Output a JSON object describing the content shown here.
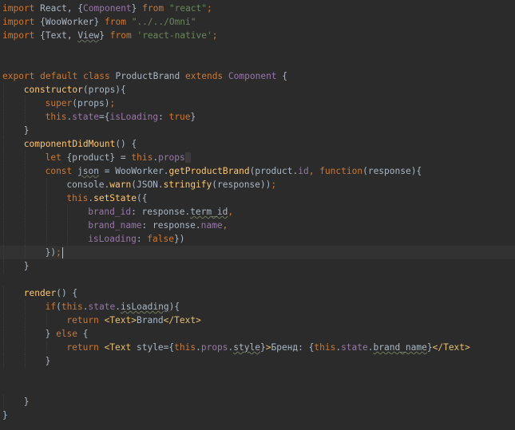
{
  "editor": {
    "lines": [
      {
        "indent": 0,
        "tokens": [
          [
            "kw",
            "import"
          ],
          [
            "plain",
            " React, {"
          ],
          [
            "prop",
            "Component"
          ],
          [
            "plain",
            "} "
          ],
          [
            "kw",
            "from"
          ],
          [
            "plain",
            " "
          ],
          [
            "str",
            "\"react\""
          ],
          [
            "kw",
            ";"
          ]
        ]
      },
      {
        "indent": 0,
        "tokens": [
          [
            "kw",
            "import"
          ],
          [
            "plain",
            " {WooWorker} "
          ],
          [
            "kw",
            "from"
          ],
          [
            "plain",
            " "
          ],
          [
            "str",
            "\"../../Omni\""
          ]
        ]
      },
      {
        "indent": 0,
        "tokens": [
          [
            "kw",
            "import"
          ],
          [
            "plain",
            " {Text, "
          ],
          [
            "dim",
            "View"
          ],
          [
            "plain",
            "} "
          ],
          [
            "kw",
            "from"
          ],
          [
            "plain",
            " "
          ],
          [
            "str",
            "'react-native'"
          ],
          [
            "kw",
            ";"
          ]
        ]
      },
      {
        "indent": 0,
        "tokens": []
      },
      {
        "indent": 0,
        "tokens": []
      },
      {
        "indent": 0,
        "tokens": [
          [
            "kw",
            "export default class"
          ],
          [
            "plain",
            " ProductBrand "
          ],
          [
            "kw",
            "extends"
          ],
          [
            "plain",
            " "
          ],
          [
            "prop",
            "Component"
          ],
          [
            "plain",
            " {"
          ]
        ]
      },
      {
        "indent": 1,
        "tokens": [
          [
            "fn",
            "constructor"
          ],
          [
            "plain",
            "(props){"
          ]
        ]
      },
      {
        "indent": 2,
        "tokens": [
          [
            "kw",
            "super"
          ],
          [
            "plain",
            "(props)"
          ],
          [
            "kw",
            ";"
          ]
        ]
      },
      {
        "indent": 2,
        "tokens": [
          [
            "kw",
            "this"
          ],
          [
            "plain",
            "."
          ],
          [
            "prop",
            "state"
          ],
          [
            "plain",
            "={"
          ],
          [
            "prop",
            "isLoading"
          ],
          [
            "plain",
            ": "
          ],
          [
            "kw",
            "true"
          ],
          [
            "plain",
            "}"
          ]
        ]
      },
      {
        "indent": 1,
        "tokens": [
          [
            "plain",
            "}"
          ]
        ]
      },
      {
        "indent": 1,
        "tokens": [
          [
            "fn",
            "componentDidMount"
          ],
          [
            "plain",
            "() {"
          ]
        ]
      },
      {
        "indent": 2,
        "tokens": [
          [
            "kw",
            "let"
          ],
          [
            "plain",
            " {product} = "
          ],
          [
            "kw",
            "this"
          ],
          [
            "plain",
            "."
          ],
          [
            "prop",
            "props"
          ],
          [
            "box",
            " "
          ]
        ]
      },
      {
        "indent": 2,
        "tokens": [
          [
            "kw",
            "const"
          ],
          [
            "plain",
            " "
          ],
          [
            "dim",
            "json"
          ],
          [
            "plain",
            " = WooWorker."
          ],
          [
            "fn",
            "getProductBrand"
          ],
          [
            "plain",
            "(product."
          ],
          [
            "prop",
            "id"
          ],
          [
            "kw",
            ","
          ],
          [
            "plain",
            " "
          ],
          [
            "kw",
            "function"
          ],
          [
            "plain",
            "(response){"
          ]
        ]
      },
      {
        "indent": 3,
        "tokens": [
          [
            "plain",
            "console."
          ],
          [
            "fn",
            "warn"
          ],
          [
            "plain",
            "(JSON."
          ],
          [
            "fn",
            "stringify"
          ],
          [
            "plain",
            "(response))"
          ],
          [
            "kw",
            ";"
          ]
        ]
      },
      {
        "indent": 3,
        "tokens": [
          [
            "kw",
            "this"
          ],
          [
            "plain",
            "."
          ],
          [
            "fn",
            "setState"
          ],
          [
            "plain",
            "({"
          ]
        ]
      },
      {
        "indent": 4,
        "tokens": [
          [
            "prop",
            "brand_id"
          ],
          [
            "plain",
            ": response."
          ],
          [
            "typo",
            "term_id"
          ],
          [
            "kw",
            ","
          ]
        ]
      },
      {
        "indent": 4,
        "tokens": [
          [
            "prop",
            "brand_name"
          ],
          [
            "plain",
            ": response."
          ],
          [
            "prop",
            "name"
          ],
          [
            "kw",
            ","
          ]
        ]
      },
      {
        "indent": 4,
        "tokens": [
          [
            "prop",
            "isLoading"
          ],
          [
            "plain",
            ": "
          ],
          [
            "kw",
            "false"
          ],
          [
            "plain",
            "})"
          ]
        ]
      },
      {
        "indent": 2,
        "current": true,
        "tokens": [
          [
            "plain",
            "})"
          ],
          [
            "kw",
            ";"
          ],
          [
            "caret",
            ""
          ]
        ]
      },
      {
        "indent": 1,
        "tokens": [
          [
            "plain",
            "}"
          ]
        ]
      },
      {
        "indent": 0,
        "tokens": []
      },
      {
        "indent": 1,
        "tokens": [
          [
            "fn",
            "render"
          ],
          [
            "plain",
            "() {"
          ]
        ]
      },
      {
        "indent": 2,
        "tokens": [
          [
            "kw",
            "if"
          ],
          [
            "plain",
            "("
          ],
          [
            "kw",
            "this"
          ],
          [
            "plain",
            "."
          ],
          [
            "prop",
            "state"
          ],
          [
            "plain",
            "."
          ],
          [
            "typo",
            "isLoading"
          ],
          [
            "plain",
            "){"
          ]
        ]
      },
      {
        "indent": 3,
        "tokens": [
          [
            "kw",
            "return"
          ],
          [
            "plain",
            " "
          ],
          [
            "tag",
            "<Text>"
          ],
          [
            "plain",
            "Brand"
          ],
          [
            "tag",
            "</Text>"
          ]
        ]
      },
      {
        "indent": 2,
        "tokens": [
          [
            "plain",
            "} "
          ],
          [
            "kw",
            "else"
          ],
          [
            "plain",
            " {"
          ]
        ]
      },
      {
        "indent": 3,
        "tokens": [
          [
            "kw",
            "return"
          ],
          [
            "plain",
            " "
          ],
          [
            "tag",
            "<Text "
          ],
          [
            "plain",
            "style={"
          ],
          [
            "kw",
            "this"
          ],
          [
            "plain",
            "."
          ],
          [
            "prop",
            "props"
          ],
          [
            "plain",
            "."
          ],
          [
            "typo",
            "style"
          ],
          [
            "plain",
            "}"
          ],
          [
            "tag",
            ">"
          ],
          [
            "plain",
            "Бренд: {"
          ],
          [
            "kw",
            "this"
          ],
          [
            "plain",
            "."
          ],
          [
            "prop",
            "state"
          ],
          [
            "plain",
            "."
          ],
          [
            "typo",
            "brand_name"
          ],
          [
            "plain",
            "}"
          ],
          [
            "tag",
            "</Text>"
          ]
        ]
      },
      {
        "indent": 2,
        "tokens": [
          [
            "plain",
            "}"
          ]
        ]
      },
      {
        "indent": 0,
        "tokens": []
      },
      {
        "indent": 0,
        "tokens": []
      },
      {
        "indent": 1,
        "tokens": [
          [
            "plain",
            "}"
          ]
        ]
      },
      {
        "indent": 0,
        "tokens": [
          [
            "plain",
            "}"
          ]
        ]
      }
    ]
  }
}
